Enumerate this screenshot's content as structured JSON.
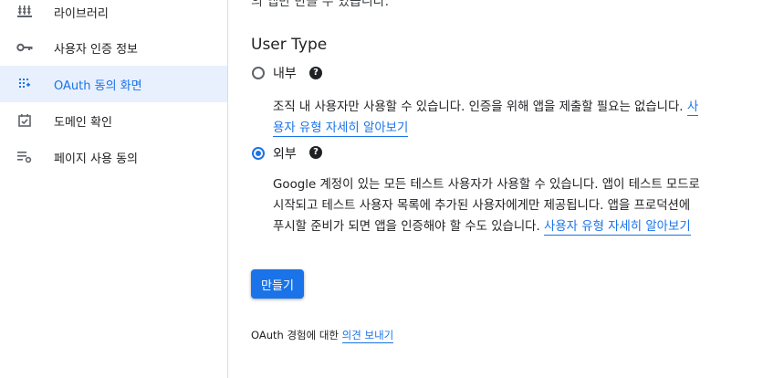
{
  "sidebar": {
    "items": [
      {
        "label": "라이브러리",
        "icon": "library-icon",
        "active": false
      },
      {
        "label": "사용자 인증 정보",
        "icon": "key-icon",
        "active": false
      },
      {
        "label": "OAuth 동의 화면",
        "icon": "consent-screen-icon",
        "active": true
      },
      {
        "label": "도메인 확인",
        "icon": "domain-check-icon",
        "active": false
      },
      {
        "label": "페이지 사용 동의",
        "icon": "page-consent-icon",
        "active": false
      }
    ]
  },
  "main": {
    "cut_text": "의 앱만 만들 수 있습니다.",
    "section_title": "User Type",
    "options": {
      "internal": {
        "label": "내부",
        "selected": false,
        "desc_line1": "조직 내 사용자만 사용할 수 있습니다. 인증을 위해 앱을 제출할 필요는 없습니다.",
        "link_part1": "사",
        "link_part2": "용자 유형 자세히 알아보기"
      },
      "external": {
        "label": "외부",
        "selected": true,
        "desc_line1": "Google 계정이 있는 모든 테스트 사용자가 사용할 수 있습니다. 앱이 테스트 모드로",
        "desc_line2": "시작되고 테스트 사용자 목록에 추가된 사용자에게만 제공됩니다. 앱을 프로덕션에",
        "desc_line3": "푸시할 준비가 되면 앱을 인증해야 할 수도 있습니다.",
        "link": "사용자 유형 자세히 알아보기"
      }
    },
    "create_button": "만들기",
    "feedback_text": "OAuth 경험에 대한",
    "feedback_link": "의견 보내기"
  },
  "colors": {
    "accent": "#1a73e8",
    "active_bg": "#e8f0fe",
    "text": "#202124"
  }
}
